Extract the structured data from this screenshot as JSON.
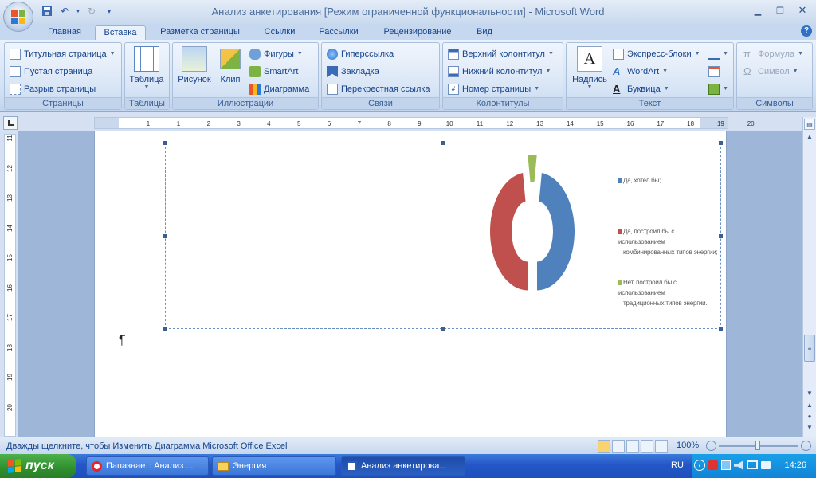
{
  "window": {
    "title": "Анализ анкетирования [Режим ограниченной функциональности] - Microsoft Word"
  },
  "tabs": [
    "Главная",
    "Вставка",
    "Разметка страницы",
    "Ссылки",
    "Рассылки",
    "Рецензирование",
    "Вид"
  ],
  "active_tab": "Вставка",
  "ribbon": {
    "pages": {
      "label": "Страницы",
      "items": [
        "Титульная страница",
        "Пустая страница",
        "Разрыв страницы"
      ]
    },
    "tables": {
      "label": "Таблицы",
      "table": "Таблица"
    },
    "illustrations": {
      "label": "Иллюстрации",
      "picture": "Рисунок",
      "clip": "Клип",
      "shapes": "Фигуры",
      "smartart": "SmartArt",
      "chart": "Диаграмма"
    },
    "links": {
      "label": "Связи",
      "items": [
        "Гиперссылка",
        "Закладка",
        "Перекрестная ссылка"
      ]
    },
    "headers": {
      "label": "Колонтитулы",
      "items": [
        "Верхний колонтитул",
        "Нижний колонтитул",
        "Номер страницы"
      ]
    },
    "text": {
      "label": "Текст",
      "textbox": "Надпись",
      "items": [
        "Экспресс-блоки",
        "WordArt",
        "Буквица"
      ]
    },
    "symbols": {
      "label": "Символы",
      "items": [
        "Формула",
        "Символ"
      ]
    }
  },
  "ruler": {
    "h_ticks": [
      "1",
      "1",
      "2",
      "3",
      "4",
      "5",
      "6",
      "7",
      "8",
      "9",
      "10",
      "11",
      "12",
      "13",
      "14",
      "15",
      "16",
      "17",
      "18",
      "19",
      "20"
    ],
    "v_ticks": [
      "11",
      "12",
      "13",
      "14",
      "15",
      "16",
      "17",
      "18",
      "19",
      "20"
    ]
  },
  "chart_data": {
    "type": "pie",
    "title": "",
    "categories": [
      "Да, хотел бы;",
      "Да, построил бы с использованием комбинированных типов энергии;",
      "Нет, построил бы с использованием традиционных типов энергии."
    ],
    "values": [
      48,
      48,
      4
    ],
    "colors": [
      "#4f81bd",
      "#c0504d",
      "#9bbb59"
    ],
    "legend_lines": [
      [
        "Да, хотел бы;"
      ],
      [
        "Да, построил бы с использованием",
        "комбинированных типов энергии;"
      ],
      [
        "Нет, построил бы с использованием",
        "традиционных типов энергии."
      ]
    ],
    "legend_position": "right"
  },
  "document": {
    "pilcrow": "¶"
  },
  "status": {
    "text": "Дважды щелкните, чтобы Изменить Диаграмма Microsoft Office Excel",
    "zoom": "100%"
  },
  "taskbar": {
    "start": "пуск",
    "items": [
      "Папазнает: Анализ ...",
      "Энергия",
      "Анализ анкетирова..."
    ],
    "lang": "RU",
    "time": "14:26"
  },
  "colors": {
    "accent": "#15428b",
    "taskbar": "#245edb",
    "start": "#3a9a38"
  }
}
